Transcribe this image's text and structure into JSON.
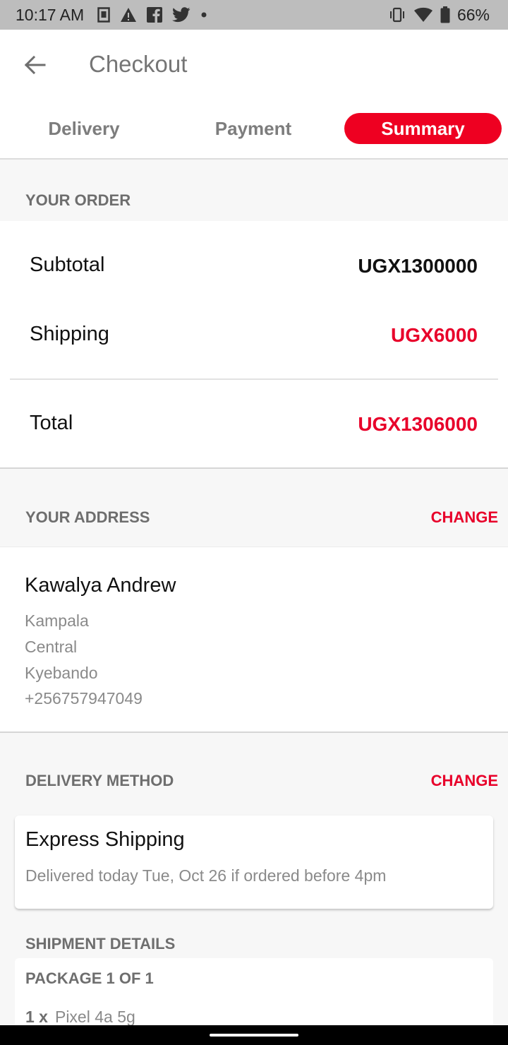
{
  "status_bar": {
    "time": "10:17 AM",
    "battery": "66%",
    "notification_icons": [
      "sim-card-icon",
      "warning-icon",
      "facebook-icon",
      "twitter-icon",
      "dot-icon"
    ],
    "system_icons": [
      "vibrate-icon",
      "wifi-icon",
      "battery-icon"
    ]
  },
  "app_bar": {
    "title": "Checkout",
    "back_icon": "arrow-back-icon"
  },
  "tabs": [
    {
      "label": "Delivery",
      "active": false
    },
    {
      "label": "Payment",
      "active": false
    },
    {
      "label": "Summary",
      "active": true
    }
  ],
  "order": {
    "section_label": "YOUR ORDER",
    "subtotal_label": "Subtotal",
    "subtotal_value": "UGX1300000",
    "shipping_label": "Shipping",
    "shipping_value": "UGX6000",
    "total_label": "Total",
    "total_value": "UGX1306000"
  },
  "address": {
    "section_label": "YOUR ADDRESS",
    "change_label": "CHANGE",
    "name": "Kawalya Andrew",
    "city": "Kampala",
    "region": "Central",
    "area": "Kyebando",
    "phone": "+256757947049"
  },
  "delivery_method": {
    "section_label": "DELIVERY METHOD",
    "change_label": "CHANGE",
    "title": "Express Shipping",
    "description": "Delivered today Tue, Oct 26 if ordered before 4pm"
  },
  "shipment": {
    "section_label": "SHIPMENT DETAILS",
    "package_label": "PACKAGE 1 OF 1",
    "item_qty": "1 x",
    "item_name": "Pixel 4a 5g"
  },
  "colors": {
    "accent": "#ee0021",
    "price_red": "#e8002a",
    "status_bar": "#bdbdbd",
    "section_bg": "#f7f7f7"
  }
}
